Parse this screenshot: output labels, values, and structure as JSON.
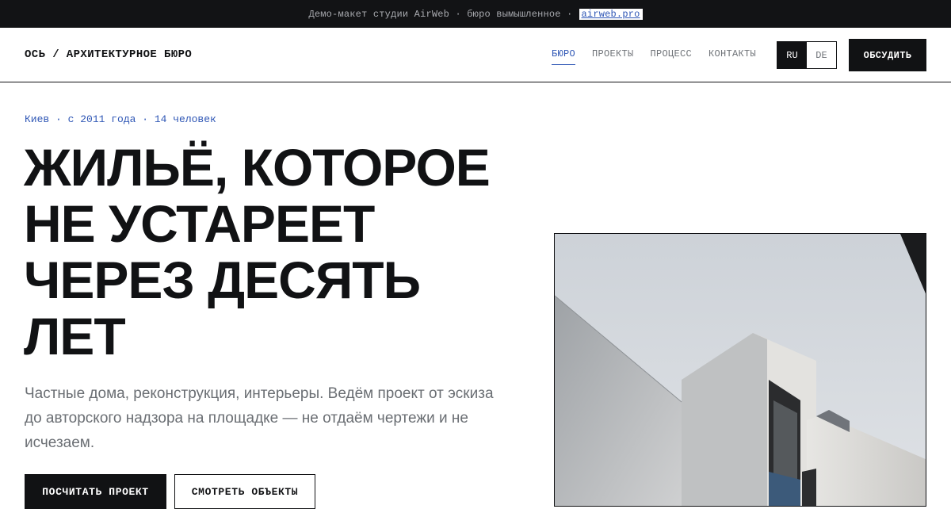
{
  "demo_bar": {
    "text": "Демо-макет студии AirWeb · бюро вымышленное ·",
    "link": "airweb.pro"
  },
  "header": {
    "logo": "ОСЬ / АРХИТЕКТУРНОЕ БЮРО",
    "nav": [
      {
        "label": "БЮРО",
        "active": true
      },
      {
        "label": "ПРОЕКТЫ",
        "active": false
      },
      {
        "label": "ПРОЦЕСС",
        "active": false
      },
      {
        "label": "КОНТАКТЫ",
        "active": false
      }
    ],
    "lang": {
      "current": "RU",
      "other": "DE"
    },
    "cta": "ОБСУДИТЬ"
  },
  "hero": {
    "meta": "Киев · с 2011 года · 14 человек",
    "headline": [
      "ЖИЛЬЁ, КОТОРОЕ",
      "НЕ УСТАРЕЕТ",
      "ЧЕРЕЗ ДЕСЯТЬ",
      "ЛЕТ"
    ],
    "lead": "Частные дома, реконструкция, интерьеры. Ведём проект от эскиза до авторского надзора на площадке — не отдаём чертежи и не исчезаем.",
    "primary_button": "ПОСЧИТАТЬ ПРОЕКТ",
    "secondary_button": "СМОТРЕТЬ ОБЪЕКТЫ"
  },
  "colors": {
    "ink": "#111214",
    "accent": "#2e56b5",
    "muted": "#6a6e73"
  }
}
